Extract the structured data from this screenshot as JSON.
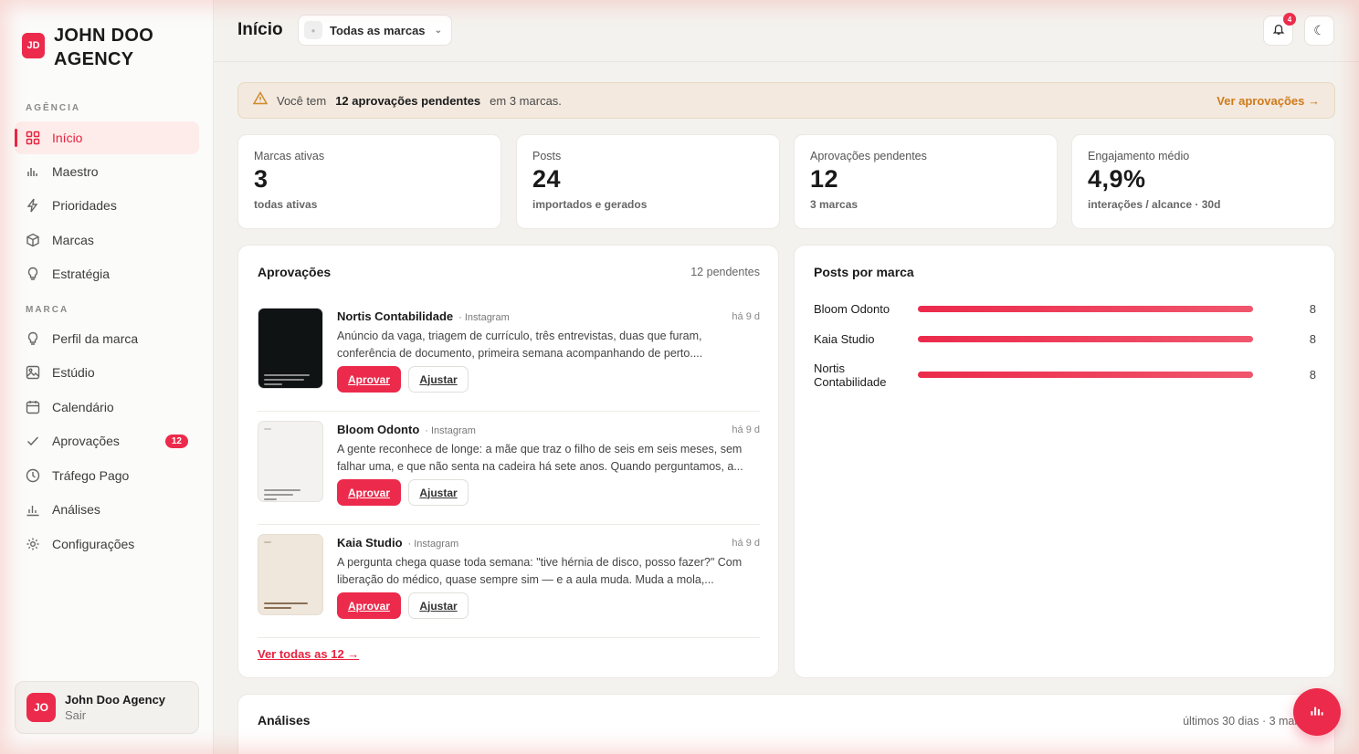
{
  "brand": {
    "initials": "JD",
    "name": "JOHN DOO AGENCY"
  },
  "sidebar": {
    "section_agency": "AGÊNCIA",
    "section_brand": "MARCA",
    "agency_items": [
      {
        "label": "Início",
        "icon": "grid-icon",
        "active": true
      },
      {
        "label": "Maestro",
        "icon": "bar-chart-icon"
      },
      {
        "label": "Prioridades",
        "icon": "lightning-icon"
      },
      {
        "label": "Marcas",
        "icon": "box-icon"
      },
      {
        "label": "Estratégia",
        "icon": "lightbulb-icon"
      }
    ],
    "brand_items": [
      {
        "label": "Perfil da marca",
        "icon": "lightbulb-icon"
      },
      {
        "label": "Estúdio",
        "icon": "image-icon"
      },
      {
        "label": "Calendário",
        "icon": "calendar-icon"
      },
      {
        "label": "Aprovações",
        "icon": "check-icon",
        "badge": "12"
      },
      {
        "label": "Tráfego Pago",
        "icon": "clock-icon"
      },
      {
        "label": "Análises",
        "icon": "analytics-icon"
      },
      {
        "label": "Configurações",
        "icon": "gear-icon"
      }
    ],
    "user": {
      "initials": "JO",
      "name": "John Doo Agency",
      "action": "Sair"
    }
  },
  "topbar": {
    "title": "Início",
    "brand_select": "Todas as marcas",
    "notifications": "4",
    "theme_icon": "☾"
  },
  "alert": {
    "prefix": "Você tem",
    "highlight": "12 aprovações pendentes",
    "suffix": "em 3 marcas.",
    "link": "Ver aprovações →"
  },
  "stats": [
    {
      "label": "Marcas ativas",
      "value": "3",
      "sub": "todas ativas"
    },
    {
      "label": "Posts",
      "value": "24",
      "sub": "importados e gerados"
    },
    {
      "label": "Aprovações pendentes",
      "value": "12",
      "sub": "3 marcas"
    },
    {
      "label": "Engajamento médio",
      "value": "4,9%",
      "sub": "interações / alcance · 30d"
    }
  ],
  "approvals": {
    "title": "Aprovações",
    "meta": "12 pendentes",
    "approve_label": "Aprovar",
    "adjust_label": "Ajustar",
    "see_all": "Ver todas as 12 →",
    "items": [
      {
        "brand": "Nortis Contabilidade",
        "channel": "· Instagram",
        "time": "há 9 d",
        "text": "Anúncio da vaga, triagem de currículo, três entrevistas, duas que furam, conferência de documento, primeira semana acompanhando de perto....",
        "thumb_bg": "#101314"
      },
      {
        "brand": "Bloom Odonto",
        "channel": "· Instagram",
        "time": "há 9 d",
        "text": "A gente reconhece de longe: a mãe que traz o filho de seis em seis meses, sem falhar uma, e que não senta na cadeira há sete anos. Quando perguntamos, a...",
        "thumb_bg": "#f3f2f0"
      },
      {
        "brand": "Kaia Studio",
        "channel": "· Instagram",
        "time": "há 9 d",
        "text": "A pergunta chega quase toda semana: \"tive hérnia de disco, posso fazer?\" Com liberação do médico, quase sempre sim — e a aula muda. Muda a mola,...",
        "thumb_bg": "#efe7dc"
      }
    ]
  },
  "posts_by_brand": {
    "title": "Posts por marca",
    "rows": [
      {
        "label": "Bloom Odonto",
        "value": "8",
        "fraction": 1.0
      },
      {
        "label": "Kaia Studio",
        "value": "8",
        "fraction": 1.0
      },
      {
        "label": "Nortis Contabilidade",
        "value": "8",
        "fraction": 1.0
      }
    ]
  },
  "analytics": {
    "title": "Análises",
    "meta": "últimos 30 dias · 3 marcas"
  },
  "colors": {
    "accent": "#ec2a4b",
    "alert_bg": "#f3e9df",
    "alert_link": "#d07a1a"
  }
}
